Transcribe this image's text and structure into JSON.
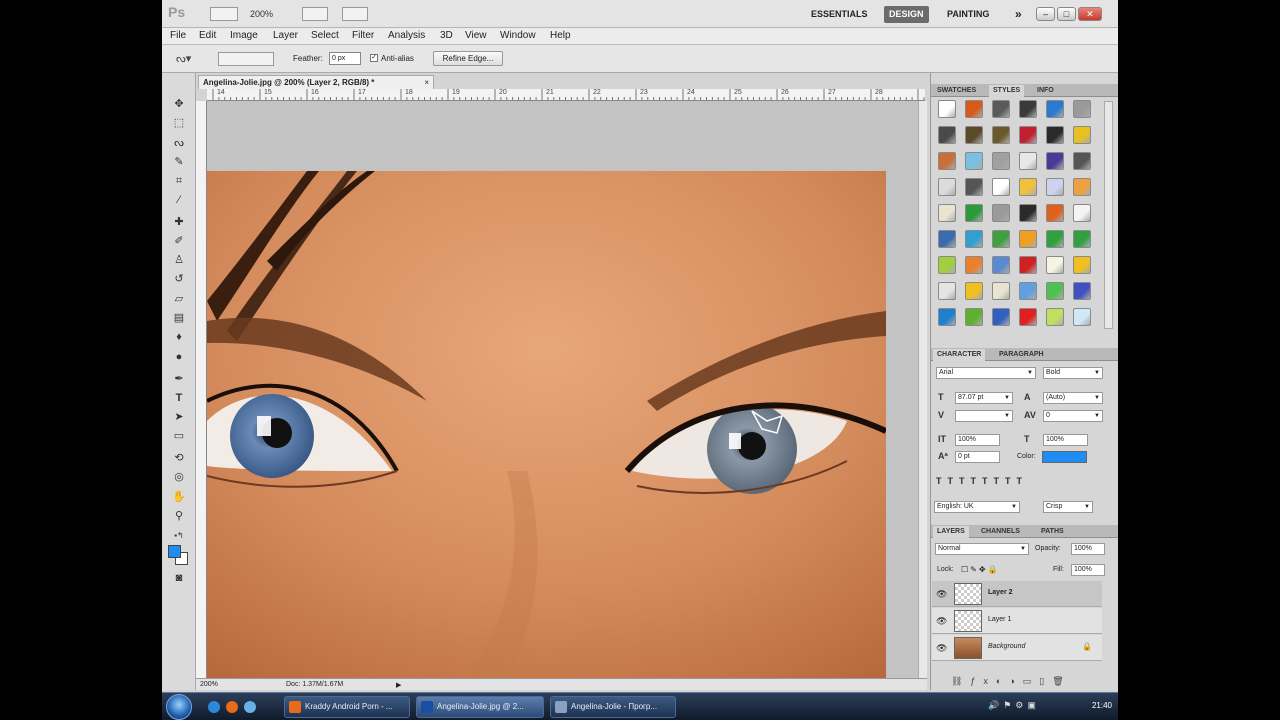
{
  "app": {
    "logo": "Ps",
    "zoom_display": "200%",
    "workspaces": [
      "ESSENTIALS",
      "DESIGN",
      "PAINTING"
    ],
    "more": "»"
  },
  "menu": [
    "File",
    "Edit",
    "Image",
    "Layer",
    "Select",
    "Filter",
    "Analysis",
    "3D",
    "View",
    "Window",
    "Help"
  ],
  "options": {
    "feather_label": "Feather:",
    "feather_value": "0 px",
    "antialias_label": "Anti-alias",
    "refine_label": "Refine Edge..."
  },
  "document": {
    "tab_title": "Angelina-Jolie.jpg @ 200% (Layer 2, RGB/8) *",
    "ruler_ticks": [
      "14",
      "15",
      "16",
      "17",
      "18",
      "19",
      "20",
      "21",
      "22",
      "23",
      "24",
      "25",
      "26",
      "27",
      "28"
    ],
    "status_zoom": "200%",
    "status_doc": "Doc: 1.37M/1.67M"
  },
  "styles_panel": {
    "tabs": [
      "SWATCHES",
      "STYLES",
      "INFO"
    ],
    "active_tab": "STYLES",
    "swatch_colors": [
      [
        "#ffffff",
        "#d85a1a",
        "#5a5a5a",
        "#3a3a3a",
        "#2a7ad0",
        "#9a9a9a"
      ],
      [
        "#4a4a4a",
        "#5a4a2a",
        "#6a5a2a",
        "#c02030",
        "#2a2a2a",
        "#e8c020"
      ],
      [
        "#c8703a",
        "#7ac0e0",
        "#a0a0a0",
        "#e8e8e8",
        "#4a3a9a",
        "#555555"
      ],
      [
        "#dcdcdc",
        "#555555",
        "#ffffff",
        "#f0c040",
        "#d0d0f0",
        "#f0a040"
      ],
      [
        "#e8e4d0",
        "#2a9a3a",
        "#9a9a9a",
        "#2a2a2a",
        "#e06020",
        "#f4f4f4"
      ],
      [
        "#3a6ab0",
        "#30a0d0",
        "#40a040",
        "#f0a020",
        "#30a040",
        "#30a040"
      ],
      [
        "#a0d040",
        "#e88030",
        "#5a8ad0",
        "#d02020",
        "#f4f4e0",
        "#f0c020"
      ],
      [
        "#e4e4e4",
        "#f0c020",
        "#e8e4d0",
        "#60a0e0",
        "#50c050",
        "#4050c0"
      ],
      [
        "#2080d0",
        "#60b030",
        "#3060c0",
        "#e02020",
        "#c0e060",
        "#d0e8f8"
      ]
    ]
  },
  "character_panel": {
    "tabs": [
      "CHARACTER",
      "PARAGRAPH"
    ],
    "font_family": "Arial",
    "font_style": "Bold",
    "font_size": "87.07 pt",
    "leading": "(Auto)",
    "kerning": "",
    "tracking": "0",
    "vscale": "100%",
    "hscale": "100%",
    "baseline": "0 pt",
    "color_label": "Color:",
    "color": "#1e8cf0",
    "language": "English: UK",
    "antialias": "Crisp"
  },
  "layers_panel": {
    "tabs": [
      "LAYERS",
      "CHANNELS",
      "PATHS"
    ],
    "blend_mode": "Normal",
    "opacity_label": "Opacity:",
    "opacity": "100%",
    "lock_label": "Lock:",
    "fill_label": "Fill:",
    "fill": "100%",
    "layers": [
      {
        "name": "Layer 2",
        "selected": true
      },
      {
        "name": "Layer 1",
        "selected": false
      },
      {
        "name": "Background",
        "selected": false
      }
    ]
  },
  "taskbar": {
    "items": [
      {
        "label": "Kraddy Android Porn - ...",
        "active": false
      },
      {
        "label": "Angelina-Jolie.jpg @ 2...",
        "active": true
      },
      {
        "label": "Angelina-Jolie - Прогр...",
        "active": false
      }
    ],
    "clock": "21:40"
  }
}
